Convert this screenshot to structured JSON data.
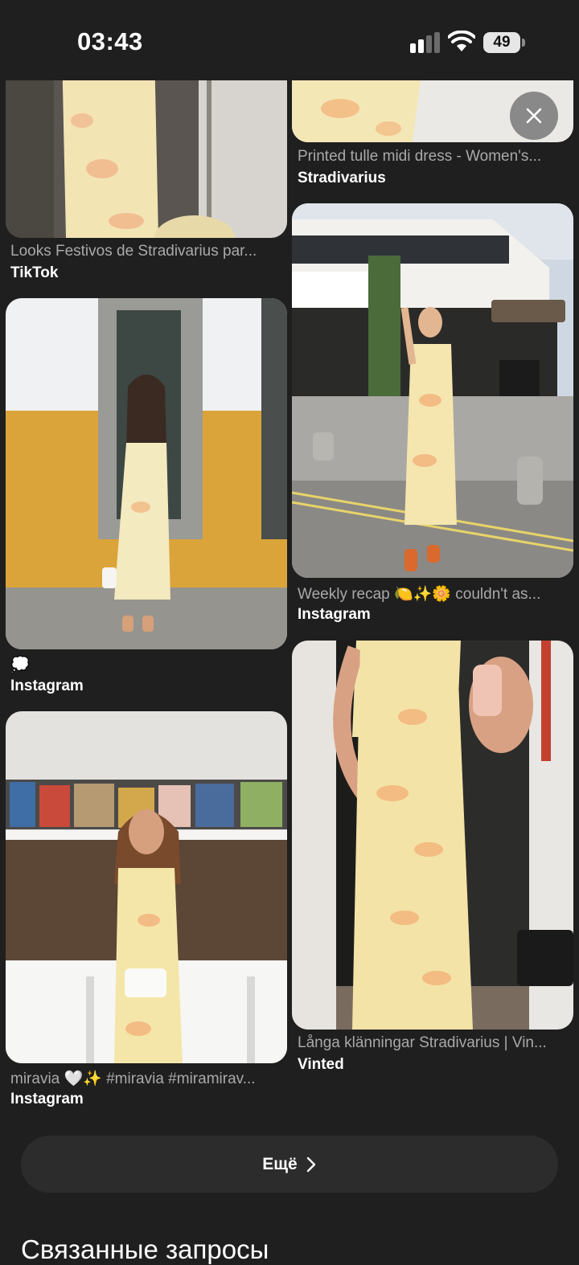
{
  "status_bar": {
    "time": "03:43",
    "battery": "49"
  },
  "results": [
    {
      "caption": "Looks Festivos de Stradivarius par...",
      "source": "TikTok"
    },
    {
      "caption": "Printed tulle midi dress - Women's...",
      "source": "Stradivarius"
    },
    {
      "caption": "Weekly recap 🍋✨🌼 couldn't as...",
      "source": "Instagram"
    },
    {
      "caption": "💭",
      "source": "Instagram"
    },
    {
      "caption": "miravia 🤍✨ #miravia #miramirav...",
      "source": "Instagram"
    },
    {
      "caption": "Långa klänningar Stradivarius | Vin...",
      "source": "Vinted"
    }
  ],
  "more_button": {
    "label": "Ещё",
    "icon": "chevron-right-icon"
  },
  "related_searches": {
    "title": "Связанные запросы"
  },
  "colors": {
    "background": "#1f1f1f",
    "button": "#2c2c2c",
    "caption": "#a9a9a9"
  }
}
